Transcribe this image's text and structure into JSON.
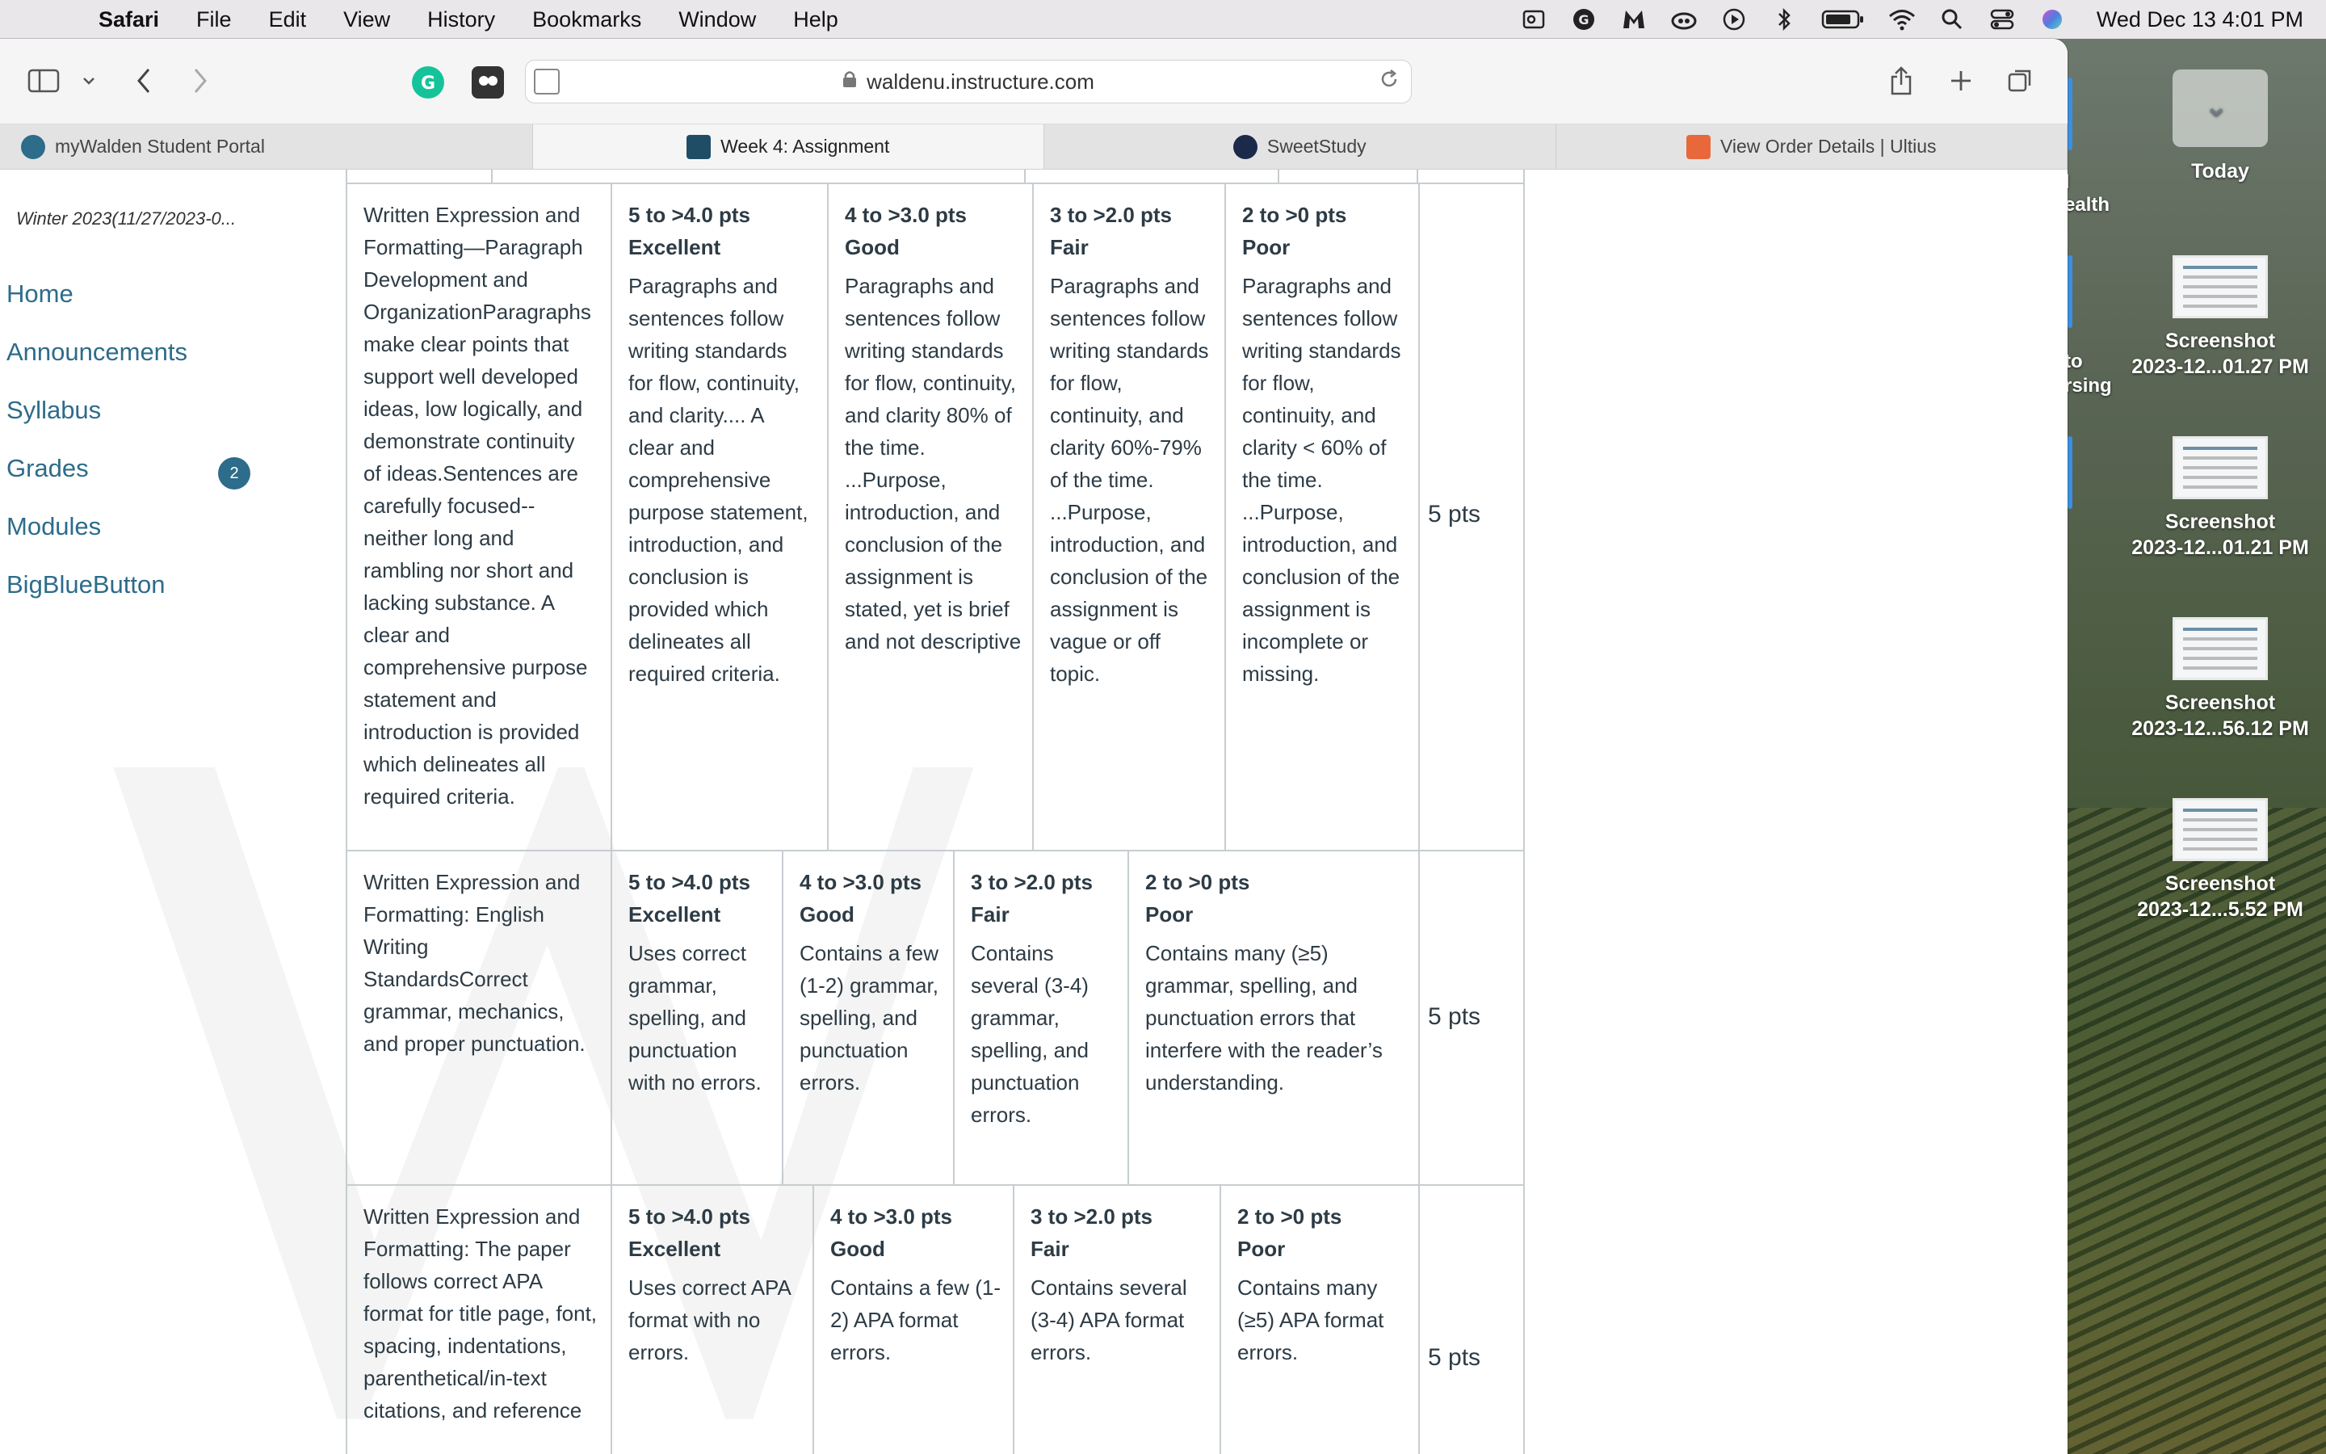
{
  "menubar": {
    "app": "Safari",
    "items": [
      "File",
      "Edit",
      "View",
      "History",
      "Bookmarks",
      "Window",
      "Help"
    ],
    "clock": "Wed Dec 13  4:01 PM",
    "status_icons": [
      "outlook-icon",
      "grammarly-icon",
      "malwarebytes-icon",
      "creative-cloud-icon",
      "play-icon",
      "bluetooth-icon",
      "battery-icon",
      "wifi-icon",
      "spotlight-icon",
      "control-center-icon",
      "siri-icon"
    ]
  },
  "browser": {
    "url": "waldenu.instructure.com",
    "tabs": [
      {
        "label": "myWalden Student Portal",
        "active": false
      },
      {
        "label": "Week 4: Assignment",
        "active": true
      },
      {
        "label": "SweetStudy",
        "active": false
      },
      {
        "label": "View Order Details | Ultius",
        "active": false
      }
    ]
  },
  "sidebar": {
    "term": "Winter 2023(11/27/2023-0...",
    "items": [
      {
        "label": "Home"
      },
      {
        "label": "Announcements"
      },
      {
        "label": "Syllabus"
      },
      {
        "label": "Grades",
        "badge": "2"
      },
      {
        "label": "Modules"
      },
      {
        "label": "BigBlueButton"
      }
    ]
  },
  "rubric": {
    "rows": [
      {
        "criterion": "Written Expression and Formatting—Paragraph Development and OrganizationParagraphs make clear points that support well developed ideas, low logically, and demonstrate continuity of ideas.Sentences are carefully focused--neither long and rambling nor short and lacking substance. A clear and comprehensive purpose statement and introduction is provided which delineates all required criteria.",
        "ratings": [
          {
            "pts": "5 to >4.0 pts",
            "level": "Excellent",
            "desc": "Paragraphs and sentences follow writing standards for flow, continuity, and clarity.... A clear and comprehensive purpose statement, introduction, and conclusion is provided which delineates all required criteria."
          },
          {
            "pts": "4 to >3.0 pts",
            "level": "Good",
            "desc": "Paragraphs and sentences follow writing standards for flow, continuity, and clarity 80% of the time. ...Purpose, introduction, and conclusion of the assignment is stated, yet is brief and not descriptive"
          },
          {
            "pts": "3 to >2.0 pts",
            "level": "Fair",
            "desc": "Paragraphs and sentences follow writing standards for flow, continuity, and clarity 60%-79% of the time. ...Purpose, introduction, and conclusion of the assignment is vague or off topic."
          },
          {
            "pts": "2 to >0 pts",
            "level": "Poor",
            "desc": "Paragraphs and sentences follow writing standards for flow, continuity, and clarity < 60% of the time. ...Purpose, introduction, and conclusion of the assignment is incomplete or missing."
          }
        ],
        "points": "5 pts"
      },
      {
        "criterion": "Written Expression and Formatting: English Writing StandardsCorrect grammar, mechanics, and proper punctuation.",
        "ratings": [
          {
            "pts": "5 to >4.0 pts",
            "level": "Excellent",
            "desc": "Uses correct grammar, spelling, and punctuation with no errors."
          },
          {
            "pts": "4 to >3.0 pts",
            "level": "Good",
            "desc": "Contains a few (1-2) grammar, spelling, and punctuation errors."
          },
          {
            "pts": "3 to >2.0 pts",
            "level": "Fair",
            "desc": "Contains several (3-4) grammar, spelling, and punctuation errors."
          },
          {
            "pts": "2 to >0 pts",
            "level": "Poor",
            "desc": "Contains many (≥5) grammar, spelling, and punctuation errors that interfere with the reader’s understanding."
          }
        ],
        "points": "5 pts"
      },
      {
        "criterion": "Written Expression and Formatting: The paper follows correct APA format for title page, font, spacing, indentations, parenthetical/in-text citations, and reference",
        "ratings": [
          {
            "pts": "5 to >4.0 pts",
            "level": "Excellent",
            "desc": "Uses correct APA format with no errors."
          },
          {
            "pts": "4 to >3.0 pts",
            "level": "Good",
            "desc": "Contains a few (1-2) APA format errors."
          },
          {
            "pts": "3 to >2.0 pts",
            "level": "Fair",
            "desc": "Contains several (3-4) APA format errors."
          },
          {
            "pts": "2 to >0 pts",
            "level": "Poor",
            "desc": "Contains many (≥5) APA format errors."
          }
        ],
        "points": "5 pts"
      }
    ]
  },
  "desktop": {
    "folder": "Today",
    "partial_labels": [
      "l",
      "ealth",
      "to",
      "rsing"
    ],
    "files": [
      {
        "line1": "Screenshot",
        "line2": "2023-12...01.27 PM"
      },
      {
        "line1": "Screenshot",
        "line2": "2023-12...01.21 PM"
      },
      {
        "line1": "Screenshot",
        "line2": "2023-12...56.12 PM"
      },
      {
        "line1": "Screenshot",
        "line2": "2023-12...5.52 PM"
      }
    ]
  }
}
